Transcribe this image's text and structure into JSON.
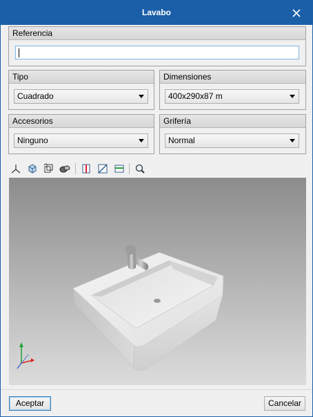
{
  "window": {
    "title": "Lavabo"
  },
  "referencia": {
    "label": "Referencia",
    "value": ""
  },
  "tipo": {
    "label": "Tipo",
    "selected": "Cuadrado"
  },
  "dimensiones": {
    "label": "Dimensiones",
    "selected": "400x290x87 m"
  },
  "accesorios": {
    "label": "Accesorios",
    "selected": "Ninguno"
  },
  "griferia": {
    "label": "Grifería",
    "selected": "Normal"
  },
  "toolbar": {
    "icons": [
      "axes-icon",
      "cube-view-icon",
      "rotate-view-icon",
      "render-mode-icon",
      "front-view-icon",
      "side-view-icon",
      "top-view-icon",
      "zoom-icon"
    ]
  },
  "footer": {
    "accept_label": "Aceptar",
    "cancel_label": "Cancelar"
  },
  "colors": {
    "titlebar": "#1a5fa8",
    "accent": "#3c7fb1"
  }
}
